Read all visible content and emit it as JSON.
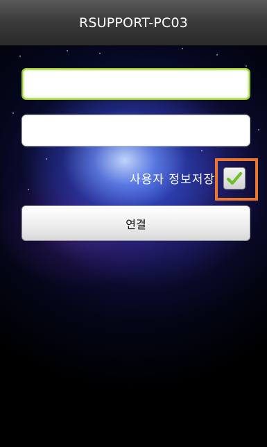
{
  "header": {
    "title": "RSUPPORT-PC03"
  },
  "form": {
    "username": {
      "value": "",
      "placeholder": ""
    },
    "password": {
      "value": "",
      "placeholder": ""
    },
    "save_user_info": {
      "label": "사용자 정보저장",
      "checked": true,
      "check_color": "#6fbf2a",
      "highlight_color": "#e9752e"
    },
    "connect_label": "연결"
  },
  "icons": {
    "checkmark": "checkmark-icon"
  }
}
